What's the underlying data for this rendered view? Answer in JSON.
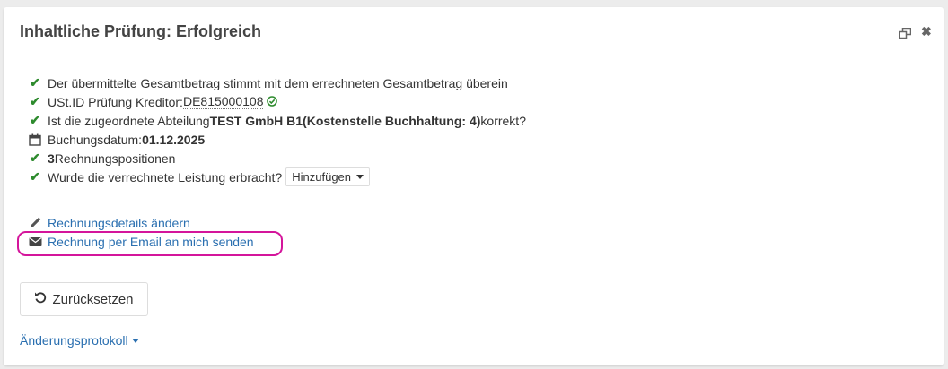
{
  "dialog": {
    "title": "Inhaltliche Prüfung: Erfolgreich",
    "controls": {
      "restore_icon": "restore-window-icon",
      "close_icon": "close-icon"
    }
  },
  "checks": {
    "total_match": "Der übermittelte Gesamtbetrag stimmt mit dem errechneten Gesamtbetrag überein",
    "vat_prefix": "USt.ID Prüfung Kreditor: ",
    "vat_id": "DE815000108",
    "department_prefix": "Ist die zugeordnete Abteilung ",
    "department_name": "TEST GmbH B1",
    "department_cost_center": " (Kostenstelle Buchhaltung: 4)",
    "department_suffix": " korrekt?",
    "booking_prefix": "Buchungsdatum: ",
    "booking_date": "01.12.2025",
    "positions_count": "3",
    "positions_label": " Rechnungspositionen",
    "service_question": "Wurde die verrechnete Leistung erbracht?",
    "service_dropdown": "Hinzufügen"
  },
  "links": {
    "edit_details": "Rechnungsdetails ändern",
    "send_email": "Rechnung per Email an mich senden"
  },
  "buttons": {
    "reset": "Zurücksetzen"
  },
  "changelog": "Änderungsprotokoll",
  "colors": {
    "check": "#2e8b2e",
    "link": "#2a6fb0",
    "highlight": "#d4159b"
  }
}
